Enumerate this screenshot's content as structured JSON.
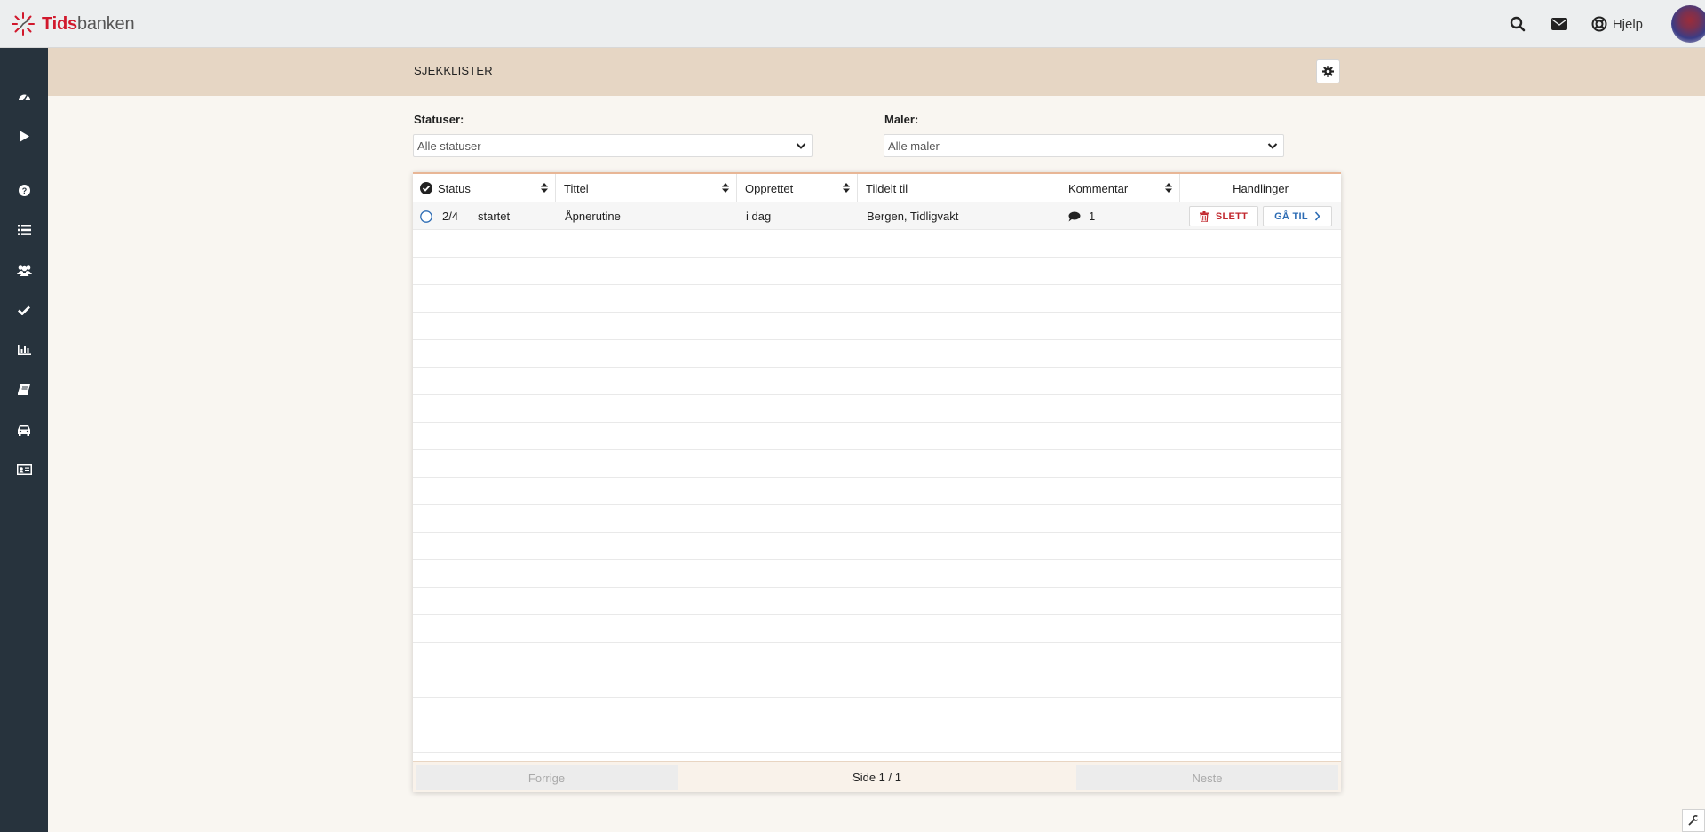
{
  "app": {
    "logo_part1": "Tids",
    "logo_part2": "banken",
    "help_label": "Hjelp"
  },
  "header": {
    "icons": [
      "search-icon",
      "envelope-icon",
      "lifebuoy-icon"
    ]
  },
  "sidebar": {
    "items": [
      {
        "icon": "dashboard-icon"
      },
      {
        "icon": "play-icon"
      },
      {
        "icon": "question-circle-icon"
      },
      {
        "icon": "list-icon"
      },
      {
        "icon": "users-icon"
      },
      {
        "icon": "check-icon"
      },
      {
        "icon": "bar-chart-icon"
      },
      {
        "icon": "book-icon"
      },
      {
        "icon": "car-icon"
      },
      {
        "icon": "id-card-icon"
      }
    ]
  },
  "page": {
    "title": "SJEKKLISTER"
  },
  "filters": {
    "status_label": "Statuser:",
    "status_value": "Alle statuser",
    "template_label": "Maler:",
    "template_value": "Alle maler"
  },
  "table": {
    "columns": [
      "Status",
      "Tittel",
      "Opprettet",
      "Tildelt til",
      "Kommentar",
      "Handlinger"
    ],
    "rows": [
      {
        "progress": "2/4",
        "status": "startet",
        "title": "Åpnerutine",
        "created": "i dag",
        "assigned_to": "Bergen, Tidligvakt",
        "comments": "1",
        "delete_label": "SLETT",
        "goto_label": "GÅ TIL"
      }
    ]
  },
  "pagination": {
    "prev_label": "Forrige",
    "page_info": "Side 1 / 1",
    "next_label": "Neste"
  },
  "colors": {
    "sidebar_bg": "#27333d",
    "banner_bg": "#e6d6c4",
    "brand_red": "#d1182c",
    "link_blue": "#2d6cb4",
    "accent_orange": "#e8b696"
  }
}
